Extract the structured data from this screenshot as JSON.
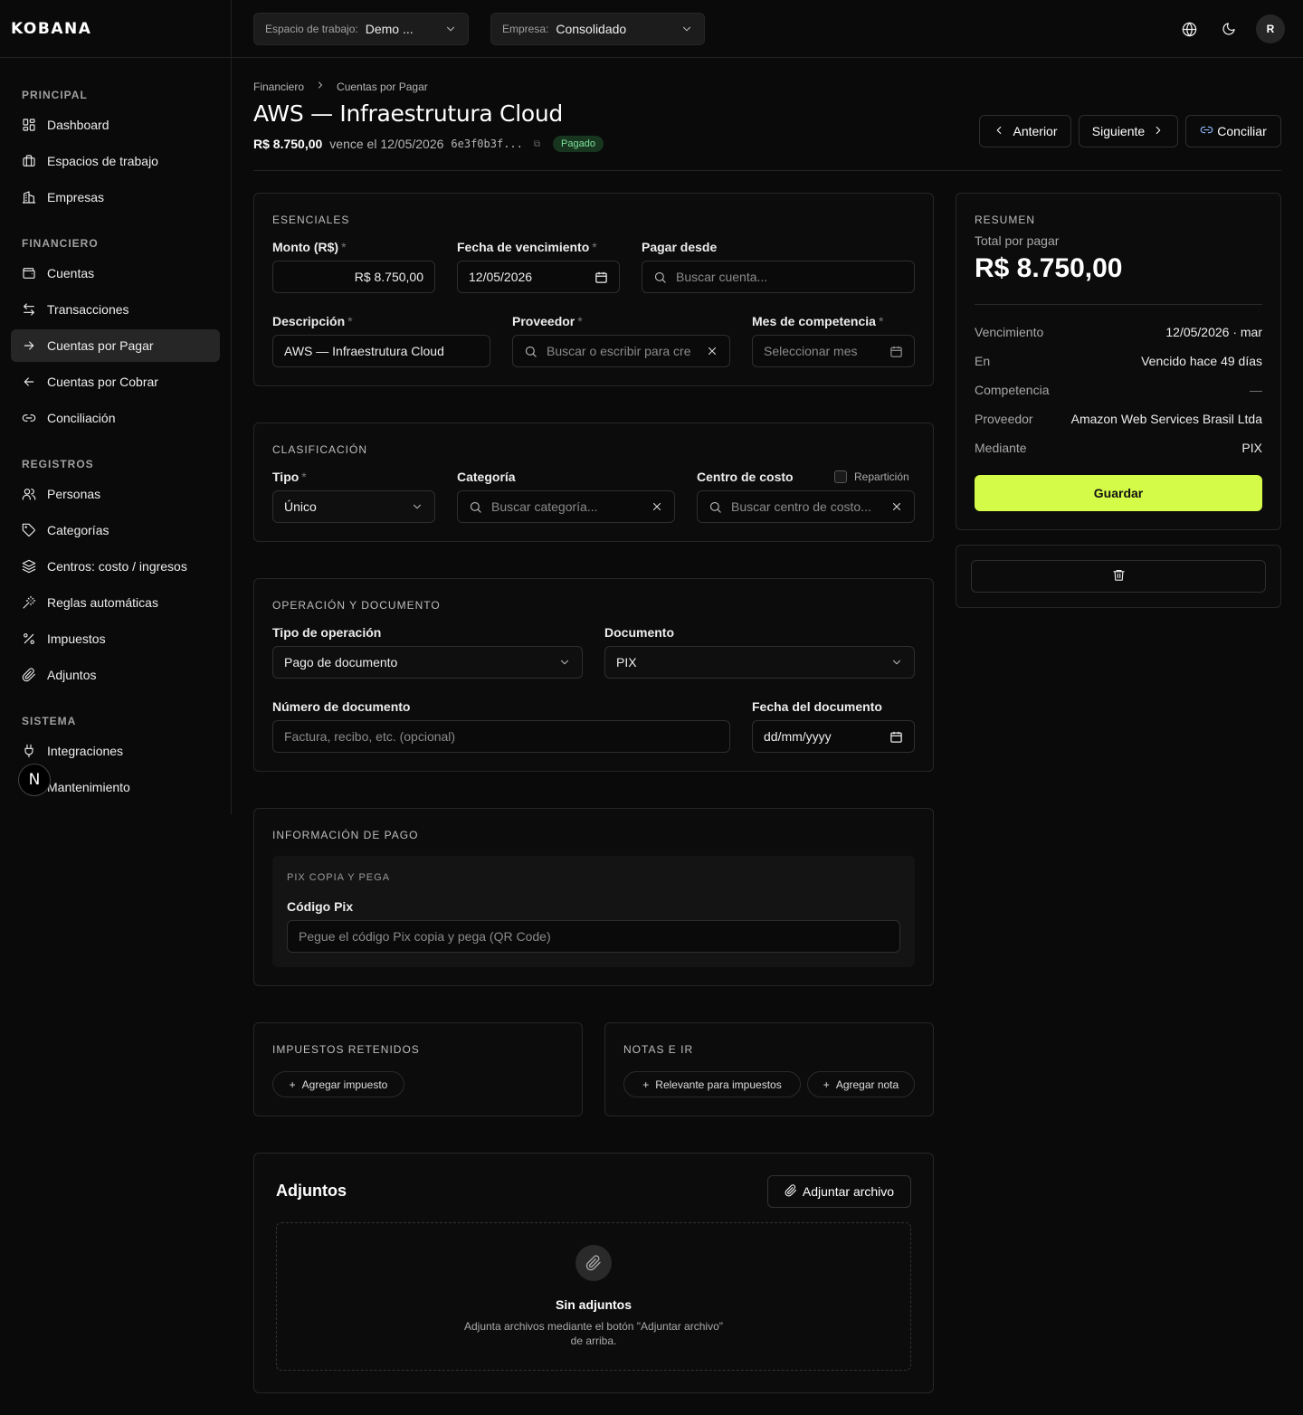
{
  "brand": {
    "logo": "KOBANA"
  },
  "topbar": {
    "workspace_label": "Espacio de trabajo:",
    "workspace_value": "Demo ...",
    "company_label": "Empresa:",
    "company_value": "Consolidado",
    "avatar_initial": "R"
  },
  "sidebar": {
    "sections": [
      {
        "title": "PRINCIPAL",
        "items": [
          "Dashboard",
          "Espacios de trabajo",
          "Empresas"
        ]
      },
      {
        "title": "FINANCIERO",
        "items": [
          "Cuentas",
          "Transacciones",
          "Cuentas por Pagar",
          "Cuentas por Cobrar",
          "Conciliación"
        ]
      },
      {
        "title": "REGISTROS",
        "items": [
          "Personas",
          "Categorías",
          "Centros: costo / ingresos",
          "Reglas automáticas",
          "Impuestos",
          "Adjuntos"
        ]
      },
      {
        "title": "SISTEMA",
        "items": [
          "Integraciones",
          "Mantenimiento"
        ]
      }
    ],
    "active_item": "Cuentas por Pagar",
    "badge_letter": "N"
  },
  "header": {
    "breadcrumb": [
      "Financiero",
      "Cuentas por Pagar"
    ],
    "title": "AWS — Infraestrutura Cloud",
    "amount": "R$ 8.750,00",
    "due_text": "vence el 12/05/2026",
    "hash": "6e3f0b3f...",
    "status": "Pagado",
    "prev_label": "Anterior",
    "next_label": "Siguiente",
    "reconcile_label": "Conciliar"
  },
  "esenciales": {
    "title": "ESENCIALES",
    "monto_label": "Monto (R$)",
    "monto_value": "R$ 8.750,00",
    "fecha_label": "Fecha de vencimiento",
    "fecha_value": "12/05/2026",
    "pagar_label": "Pagar desde",
    "pagar_placeholder": "Buscar cuenta...",
    "descripcion_label": "Descripción",
    "descripcion_value": "AWS — Infraestrutura Cloud",
    "proveedor_label": "Proveedor",
    "proveedor_placeholder": "Buscar o escribir para cre",
    "mes_label": "Mes de competencia",
    "mes_placeholder": "Seleccionar mes"
  },
  "clasificacion": {
    "title": "CLASIFICACIÓN",
    "tipo_label": "Tipo",
    "tipo_value": "Único",
    "categoria_label": "Categoría",
    "categoria_placeholder": "Buscar categoría...",
    "centro_label": "Centro de costo",
    "reparticion_label": "Repartición",
    "centro_placeholder": "Buscar centro de costo..."
  },
  "operacion": {
    "title": "OPERACIÓN Y DOCUMENTO",
    "tipo_op_label": "Tipo de operación",
    "tipo_op_value": "Pago de documento",
    "documento_label": "Documento",
    "documento_value": "PIX",
    "numero_label": "Número de documento",
    "numero_placeholder": "Factura, recibo, etc. (opcional)",
    "fecha_doc_label": "Fecha del documento",
    "fecha_doc_placeholder": "dd/mm/yyyy"
  },
  "pago": {
    "title": "INFORMACIÓN DE PAGO",
    "sub_title": "PIX COPIA Y PEGA",
    "codigo_label": "Código Pix",
    "codigo_placeholder": "Pegue el código Pix copia y pega (QR Code)"
  },
  "impuestos": {
    "title": "IMPUESTOS RETENIDOS",
    "add_label": "Agregar impuesto"
  },
  "notas": {
    "title": "NOTAS E IR",
    "relevant_label": "Relevante para impuestos",
    "add_note_label": "Agregar nota"
  },
  "adjuntos": {
    "title": "Adjuntos",
    "attach_label": "Adjuntar archivo",
    "empty_title": "Sin adjuntos",
    "empty_text_1": "Adjunta archivos mediante el botón \"Adjuntar archivo\"",
    "empty_text_2": "de arriba."
  },
  "resumen": {
    "title": "RESUMEN",
    "total_label": "Total por pagar",
    "total_value": "R$ 8.750,00",
    "rows": [
      {
        "k": "Vencimiento",
        "v": "12/05/2026 · mar"
      },
      {
        "k": "En",
        "v": "Vencido hace 49 días"
      },
      {
        "k": "Competencia",
        "v": "—"
      },
      {
        "k": "Proveedor",
        "v": "Amazon Web Services Brasil Ltda"
      },
      {
        "k": "Mediante",
        "v": "PIX"
      }
    ],
    "save_label": "Guardar"
  },
  "colors": {
    "accent": "#d4fb47",
    "background": "#0a0a0a",
    "status_paid": "#7ee39a"
  }
}
